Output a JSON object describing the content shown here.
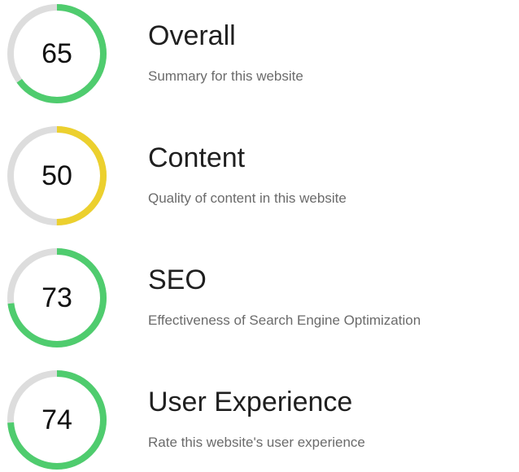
{
  "colors": {
    "track": "#dddddd",
    "good": "#4fcc6e",
    "average": "#ecd02e"
  },
  "scores": [
    {
      "value": 65,
      "value_text": "65",
      "title": "Overall",
      "description": "Summary for this website",
      "status": "good"
    },
    {
      "value": 50,
      "value_text": "50",
      "title": "Content",
      "description": "Quality of content in this website",
      "status": "average"
    },
    {
      "value": 73,
      "value_text": "73",
      "title": "SEO",
      "description": "Effectiveness of Search Engine Optimization",
      "status": "good"
    },
    {
      "value": 74,
      "value_text": "74",
      "title": "User Experience",
      "description": "Rate this website's user experience",
      "status": "good"
    }
  ]
}
